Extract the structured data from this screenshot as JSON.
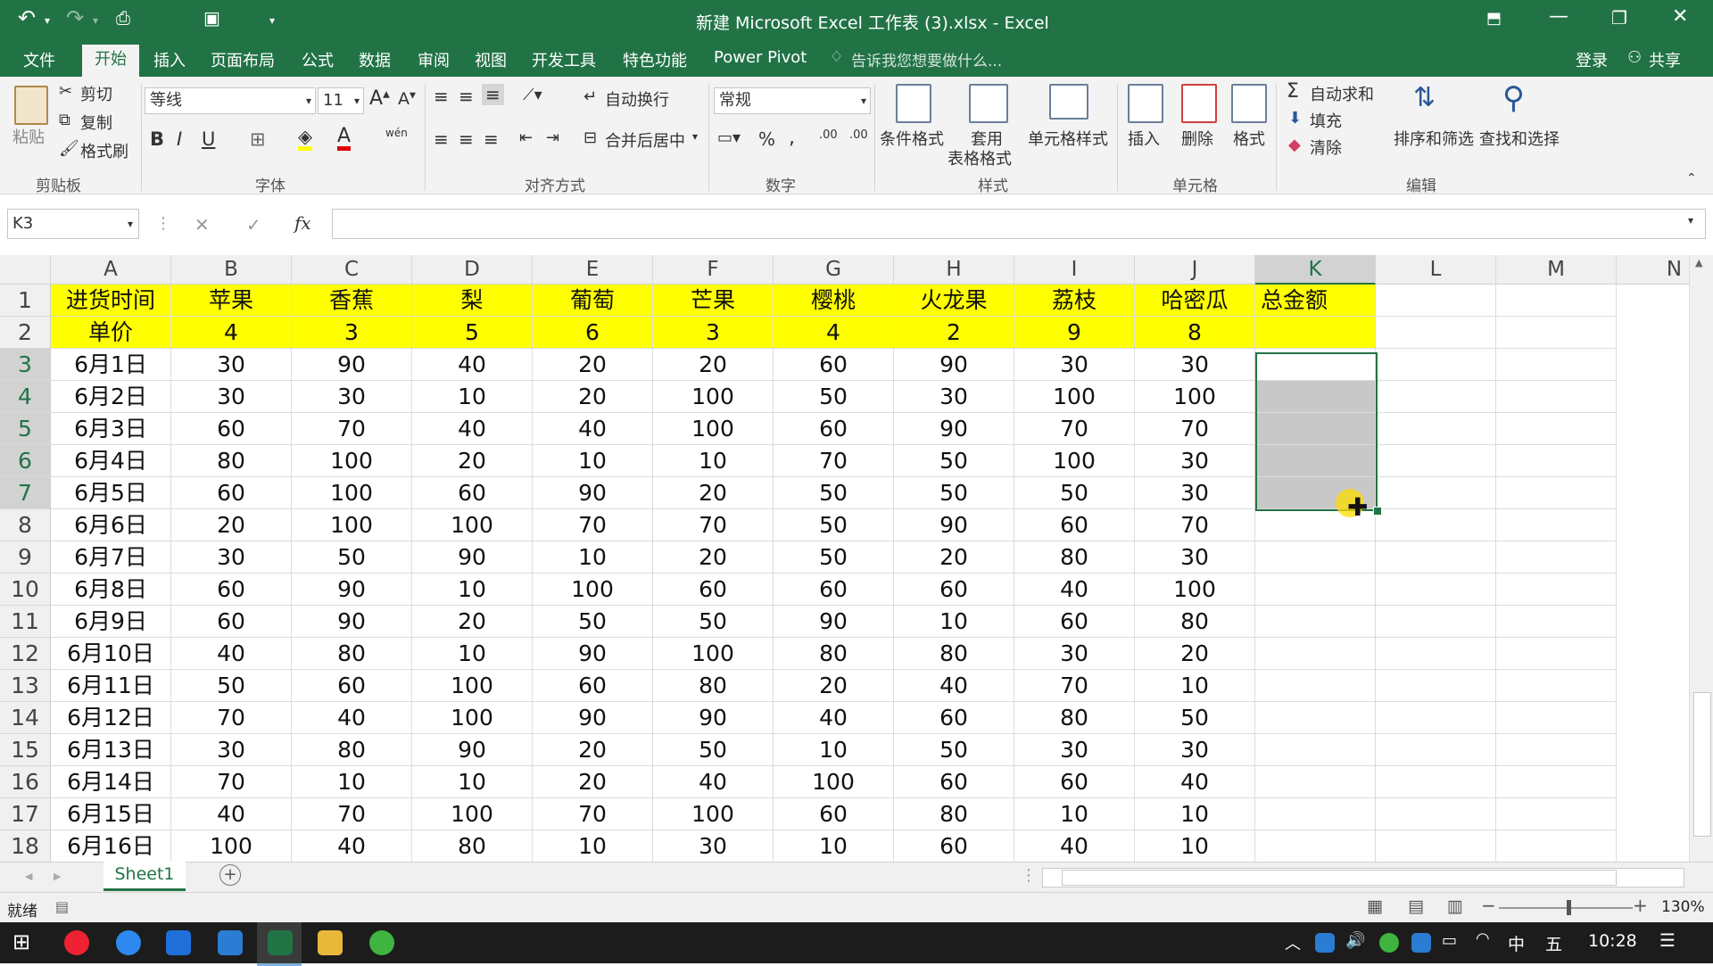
{
  "title_bar": {
    "title": "新建 Microsoft Excel 工作表 (3).xlsx - Excel",
    "undo_icon": "undo-icon",
    "redo_icon": "redo-icon",
    "save_icon": "save-icon"
  },
  "ribbon_tabs": [
    "文件",
    "开始",
    "插入",
    "页面布局",
    "公式",
    "数据",
    "审阅",
    "视图",
    "开发工具",
    "特色功能",
    "Power Pivot"
  ],
  "active_tab": "开始",
  "tell_me": "告诉我您想要做什么...",
  "login": "登录",
  "share": "共享",
  "clipboard": {
    "paste": "粘贴",
    "cut": "剪切",
    "copy": "复制",
    "format_painter": "格式刷",
    "group": "剪贴板"
  },
  "font": {
    "name": "等线",
    "size": "11",
    "group": "字体",
    "wen": "wén"
  },
  "alignment": {
    "wrap": "自动换行",
    "merge": "合并后居中",
    "group": "对齐方式"
  },
  "number": {
    "format": "常规",
    "percent": "%",
    "comma": ",",
    "group": "数字"
  },
  "styles": {
    "conditional": "条件格式",
    "table_line1": "套用",
    "table_line2": "表格格式",
    "cell_styles": "单元格样式",
    "group": "样式"
  },
  "cells": {
    "insert": "插入",
    "delete": "删除",
    "format": "格式",
    "group": "单元格"
  },
  "editing": {
    "autosum": "自动求和",
    "fill": "填充",
    "clear": "清除",
    "sort": "排序和筛选",
    "find": "查找和选择",
    "group": "编辑"
  },
  "formula_bar": {
    "name_box": "K3",
    "fx": "fx",
    "content": ""
  },
  "columns": [
    "A",
    "B",
    "C",
    "D",
    "E",
    "F",
    "G",
    "H",
    "I",
    "J",
    "K",
    "L",
    "M",
    "N"
  ],
  "row_numbers": [
    "1",
    "2",
    "3",
    "4",
    "5",
    "6",
    "7",
    "8",
    "9",
    "10",
    "11",
    "12",
    "13",
    "14",
    "15",
    "16",
    "17",
    "18"
  ],
  "rows": [
    [
      "进货时间",
      "苹果",
      "香蕉",
      "梨",
      "葡萄",
      "芒果",
      "樱桃",
      "火龙果",
      "荔枝",
      "哈密瓜",
      "总金额"
    ],
    [
      "单价",
      "4",
      "3",
      "5",
      "6",
      "3",
      "4",
      "2",
      "9",
      "8",
      ""
    ],
    [
      "6月1日",
      "30",
      "90",
      "40",
      "20",
      "20",
      "60",
      "90",
      "30",
      "30",
      ""
    ],
    [
      "6月2日",
      "30",
      "30",
      "10",
      "20",
      "100",
      "50",
      "30",
      "100",
      "100",
      ""
    ],
    [
      "6月3日",
      "60",
      "70",
      "40",
      "40",
      "100",
      "60",
      "90",
      "70",
      "70",
      ""
    ],
    [
      "6月4日",
      "80",
      "100",
      "20",
      "10",
      "10",
      "70",
      "50",
      "100",
      "30",
      ""
    ],
    [
      "6月5日",
      "60",
      "100",
      "60",
      "90",
      "20",
      "50",
      "50",
      "50",
      "30",
      ""
    ],
    [
      "6月6日",
      "20",
      "100",
      "100",
      "70",
      "70",
      "50",
      "90",
      "60",
      "70",
      ""
    ],
    [
      "6月7日",
      "30",
      "50",
      "90",
      "10",
      "20",
      "50",
      "20",
      "80",
      "30",
      ""
    ],
    [
      "6月8日",
      "60",
      "90",
      "10",
      "100",
      "60",
      "60",
      "60",
      "40",
      "100",
      ""
    ],
    [
      "6月9日",
      "60",
      "90",
      "20",
      "50",
      "50",
      "90",
      "10",
      "60",
      "80",
      ""
    ],
    [
      "6月10日",
      "40",
      "80",
      "10",
      "90",
      "100",
      "80",
      "80",
      "30",
      "20",
      ""
    ],
    [
      "6月11日",
      "50",
      "60",
      "100",
      "60",
      "80",
      "20",
      "40",
      "70",
      "10",
      ""
    ],
    [
      "6月12日",
      "70",
      "40",
      "100",
      "90",
      "90",
      "40",
      "60",
      "80",
      "50",
      ""
    ],
    [
      "6月13日",
      "30",
      "80",
      "90",
      "20",
      "50",
      "10",
      "50",
      "30",
      "30",
      ""
    ],
    [
      "6月14日",
      "70",
      "10",
      "10",
      "20",
      "40",
      "100",
      "60",
      "60",
      "40",
      ""
    ],
    [
      "6月15日",
      "40",
      "70",
      "100",
      "70",
      "100",
      "60",
      "80",
      "10",
      "10",
      ""
    ],
    [
      "6月16日",
      "100",
      "40",
      "80",
      "10",
      "30",
      "10",
      "60",
      "40",
      "10",
      ""
    ]
  ],
  "selection": "K3:K7",
  "sheet_tab": "Sheet1",
  "status": {
    "ready": "就绪",
    "zoom": "130%"
  },
  "taskbar": {
    "time": "10:28",
    "ime_lang": "中",
    "ime_mode": "五"
  },
  "colors": {
    "excel_green": "#217346",
    "header_yellow": "#ffff00",
    "selection_gray": "#c8c8c8"
  }
}
